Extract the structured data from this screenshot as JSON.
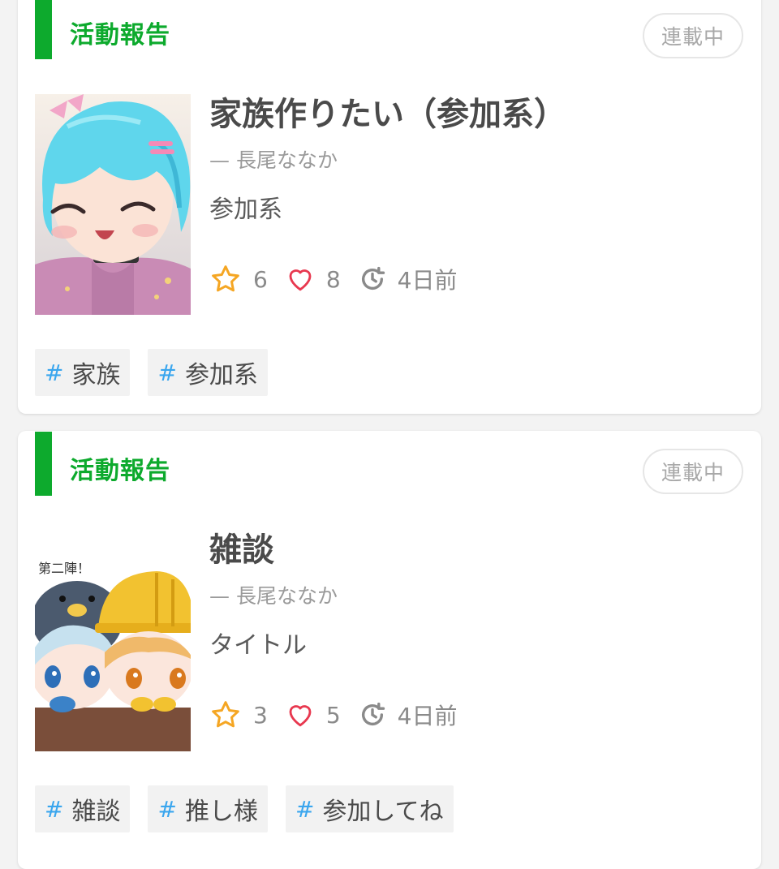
{
  "posts": [
    {
      "category": "活動報告",
      "status": "連載中",
      "title": "家族作りたい（参加系）",
      "author": "— 長尾ななか",
      "description": "参加系",
      "stars": "6",
      "likes": "8",
      "updated": "4日前",
      "thumbnail_icon": "anime-girl-thumbnail",
      "tags": [
        {
          "hash": "#",
          "label": "家族"
        },
        {
          "hash": "#",
          "label": "参加系"
        }
      ]
    },
    {
      "category": "活動報告",
      "status": "連載中",
      "title": "雑談",
      "author": "— 長尾ななか",
      "description": "タイトル",
      "stars": "3",
      "likes": "5",
      "updated": "4日前",
      "thumbnail_icon": "anime-duo-thumbnail",
      "thumbnail_caption": "第二陣！",
      "tags": [
        {
          "hash": "#",
          "label": "雑談"
        },
        {
          "hash": "#",
          "label": "推し様"
        },
        {
          "hash": "#",
          "label": "参加してね"
        }
      ]
    }
  ],
  "colors": {
    "accent_green": "#0daa2d",
    "star": "#f5a623",
    "heart": "#e8384f",
    "hash": "#3aa6ee"
  },
  "icons": {
    "star": "star-icon",
    "heart": "heart-icon",
    "clock": "history-icon"
  }
}
